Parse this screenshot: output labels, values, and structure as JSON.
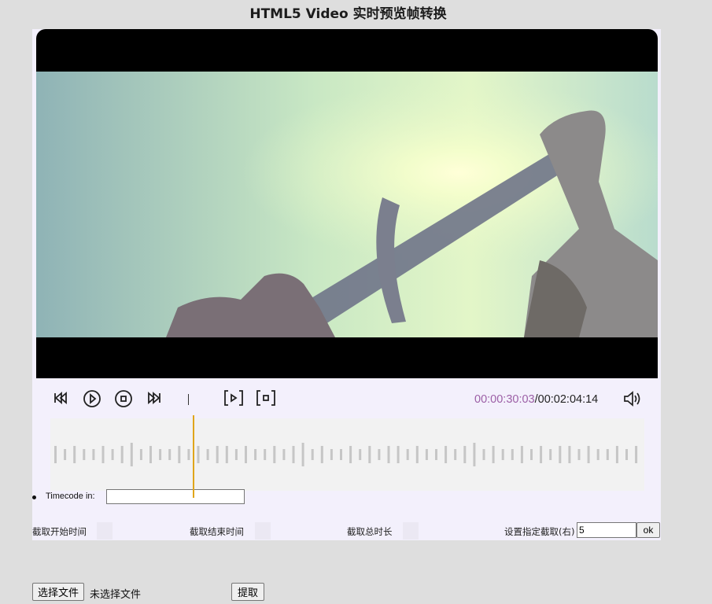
{
  "page": {
    "title": "HTML5 Video 实时预览帧转换"
  },
  "player": {
    "current_time": "00:00:30:03",
    "separator": "/",
    "total_time": "00:02:04:14",
    "icons": [
      "rewind-icon",
      "play-icon",
      "stop-icon",
      "fast-forward-icon",
      "step-frame-icon",
      "capture-frame-icon",
      "volume-icon"
    ],
    "accent_color": "#9c5fa6",
    "playhead_color": "#e0a51a"
  },
  "timecode": {
    "label": "Timecode in:",
    "value": ""
  },
  "stats": {
    "start_label": "截取开始时间",
    "end_label": "截取结束时间",
    "duration_label": "截取总时长",
    "set_label": "设置指定截取(右)",
    "set_value": "5",
    "ok_label": "ok"
  },
  "file": {
    "choose_label": "选择文件",
    "status": "未选择文件",
    "extract_label": "提取"
  }
}
